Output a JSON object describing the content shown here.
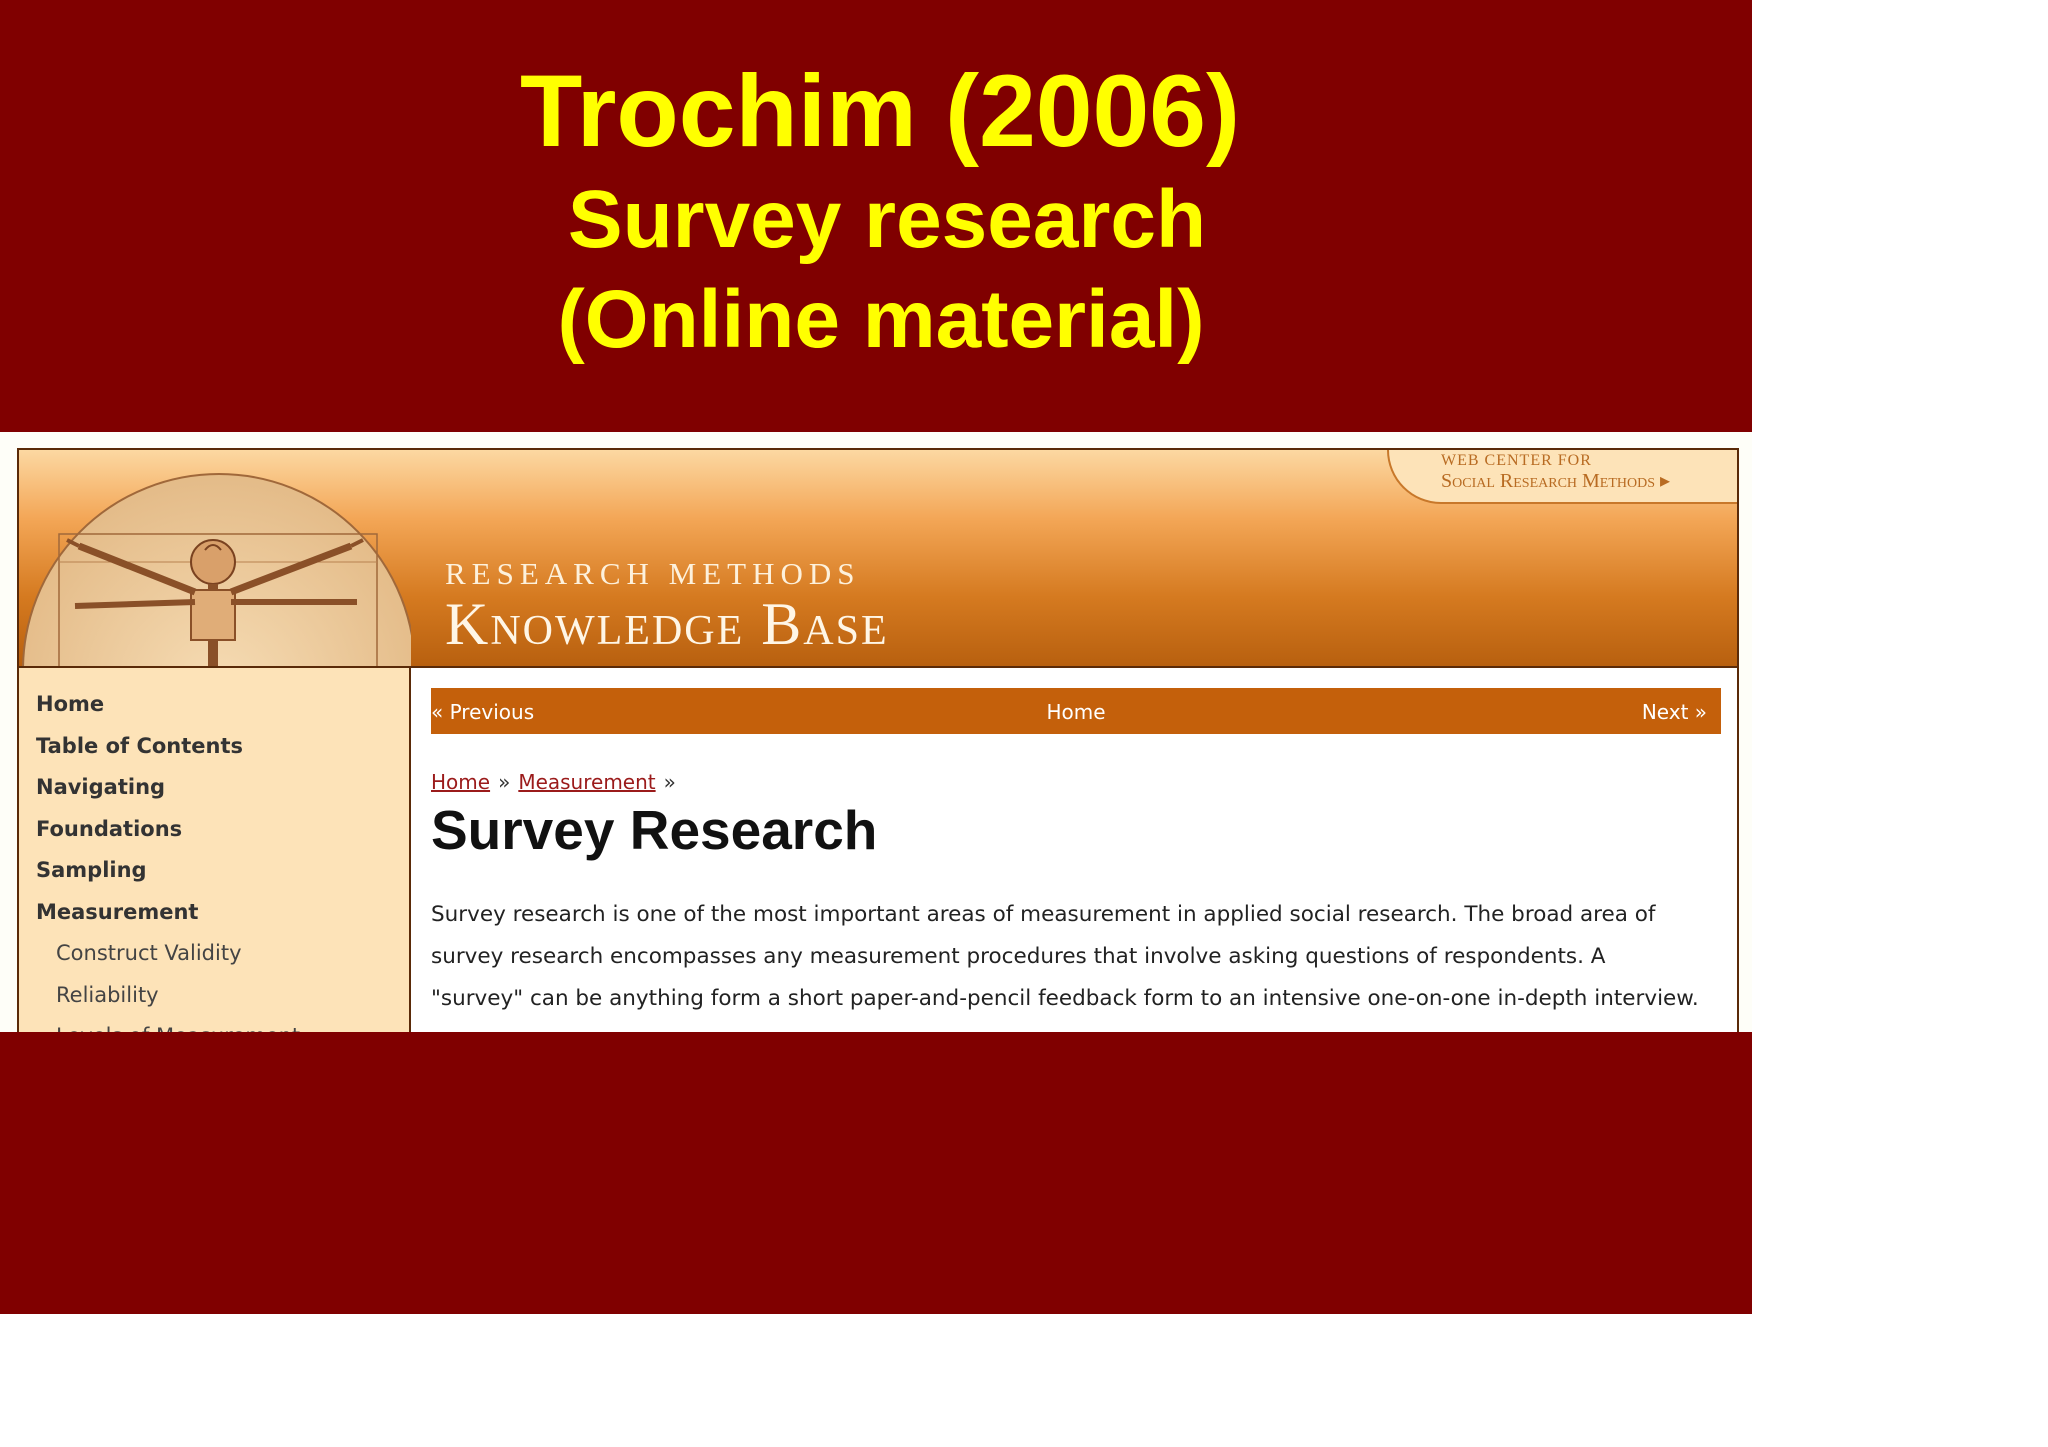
{
  "slide": {
    "title_line1": "Trochim (2006)",
    "title_line2": "Survey research",
    "title_line3": "(Online material)",
    "background_color": "#800000",
    "title_color": "#ffff00"
  },
  "site": {
    "web_center_line1": "WEB CENTER FOR",
    "web_center_line2": "Social Research Methods",
    "web_center_arrow": "▸",
    "banner_small": "RESEARCH METHODS",
    "banner_big": "Knowledge Base"
  },
  "sidebar": {
    "items": [
      {
        "label": "Home"
      },
      {
        "label": "Table of Contents"
      },
      {
        "label": "Navigating"
      },
      {
        "label": "Foundations"
      },
      {
        "label": "Sampling"
      },
      {
        "label": "Measurement"
      },
      {
        "label": "Construct Validity"
      },
      {
        "label": "Reliability"
      },
      {
        "label": "Levels of Measurement"
      }
    ]
  },
  "navbar": {
    "prev": "« Previous",
    "home": "Home",
    "next": "Next »"
  },
  "breadcrumb": {
    "home": "Home",
    "measurement": "Measurement",
    "separator": "»"
  },
  "page": {
    "title": "Survey Research",
    "line1": "Survey research is one of the most important areas of measurement in applied social research. The broad area of",
    "line2": "survey research encompasses any measurement procedures that involve asking questions of respondents. A",
    "line3": "\"survey\" can be anything form a short paper-and-pencil feedback form to an intensive one-on-one in-depth interview."
  }
}
